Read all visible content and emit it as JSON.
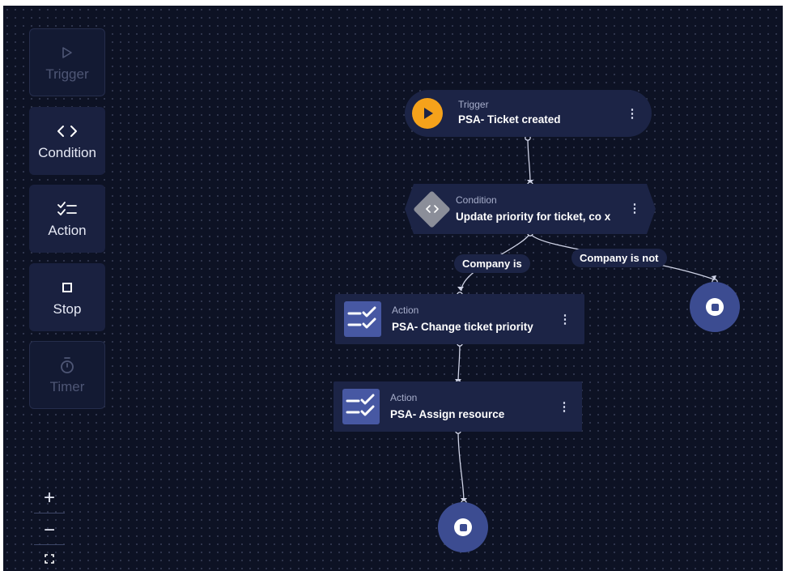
{
  "palette": {
    "trigger": {
      "label": "Trigger",
      "icon": "play-outline-icon",
      "enabled": false
    },
    "condition": {
      "label": "Condition",
      "icon": "code-brackets-icon",
      "enabled": true
    },
    "action": {
      "label": "Action",
      "icon": "checklist-icon",
      "enabled": true
    },
    "stop": {
      "label": "Stop",
      "icon": "stop-square-icon",
      "enabled": true
    },
    "timer": {
      "label": "Timer",
      "icon": "stopwatch-icon",
      "enabled": false
    }
  },
  "zoom": {
    "zoom_in": "+",
    "zoom_out": "−",
    "fit_icon": "fit-screen-icon"
  },
  "flow": {
    "trigger": {
      "kind": "Trigger",
      "title": "PSA- Ticket created",
      "icon": "play-icon"
    },
    "condition": {
      "kind": "Condition",
      "title": "Update priority for ticket, co x",
      "icon": "code-brackets-icon"
    },
    "branch_true_label": "Company is",
    "branch_false_label": "Company is not",
    "actions": [
      {
        "kind": "Action",
        "title": "PSA- Change ticket priority",
        "icon": "checklist-icon"
      },
      {
        "kind": "Action",
        "title": "PSA- Assign resource",
        "icon": "checklist-icon"
      }
    ],
    "stop_icon": "stop-circle-icon",
    "menu_glyph": "⋮"
  },
  "colors": {
    "canvas_bg": "#0d1224",
    "node_bg": "#1c2446",
    "trigger_accent": "#f5a21b",
    "action_icon_bg": "#4758a3",
    "stop_bg": "#3c4c91",
    "condition_diamond": "#8b8e99"
  }
}
